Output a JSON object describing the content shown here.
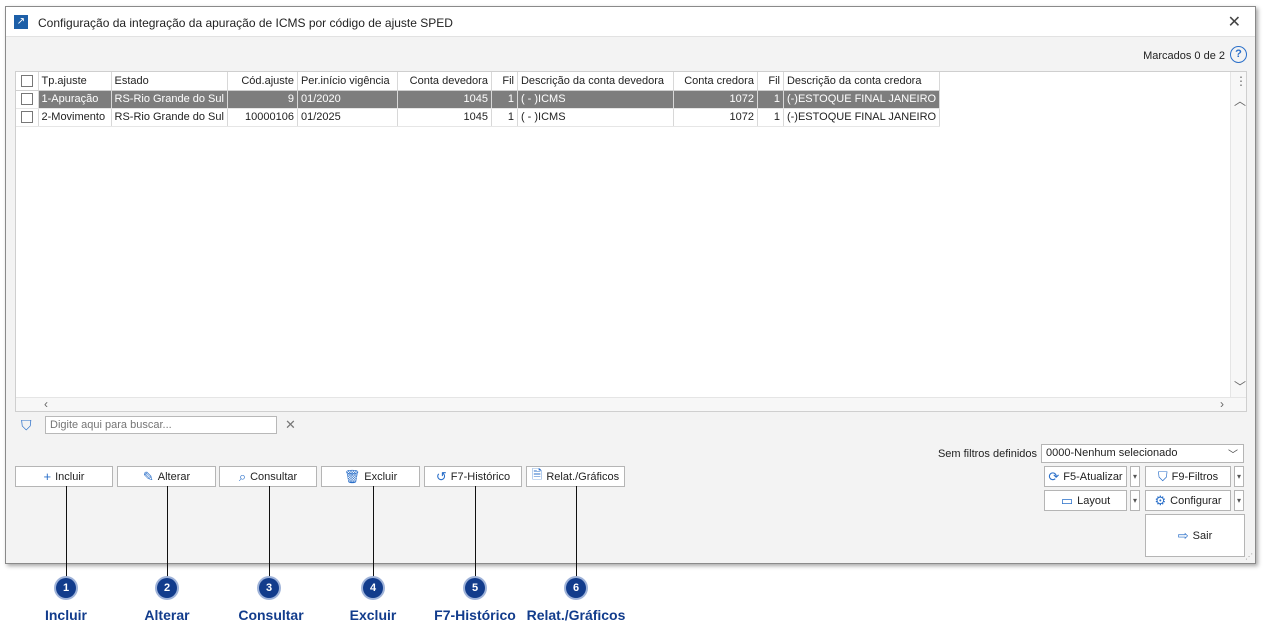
{
  "window": {
    "title": "Configuração da integração da apuração de ICMS por código de ajuste SPED",
    "marked": "Marcados 0 de 2",
    "help": "?"
  },
  "grid": {
    "columns": [
      "Tp.ajuste",
      "Estado",
      "Cód.ajuste",
      "Per.início vigência",
      "Conta devedora",
      "Fil",
      "Descrição da conta devedora",
      "Conta credora",
      "Fil",
      "Descrição da conta credora"
    ],
    "rows": [
      [
        "1-Apuração",
        "RS-Rio Grande do Sul",
        "9",
        "01/2020",
        "1045",
        "1",
        "( - )ICMS",
        "1072",
        "1",
        "(-)ESTOQUE FINAL JANEIRO"
      ],
      [
        "2-Movimento",
        "RS-Rio Grande do Sul",
        "10000106",
        "01/2025",
        "1045",
        "1",
        "( - )ICMS",
        "1072",
        "1",
        "(-)ESTOQUE FINAL JANEIRO"
      ]
    ]
  },
  "search": {
    "placeholder": "Digite aqui para buscar..."
  },
  "buttons": {
    "incluir": "Incluir",
    "alterar": "Alterar",
    "consultar": "Consultar",
    "excluir": "Excluir",
    "historico": "F7-Histórico",
    "relat": "Relat./Gráficos",
    "atualizar": "F5-Atualizar",
    "filtros": "F9-Filtros",
    "layout": "Layout",
    "configurar": "Configurar",
    "sair": "Sair"
  },
  "filters": {
    "label": "Sem filtros definidos",
    "selected": "0000-Nenhum selecionado"
  },
  "annotations": [
    {
      "num": "1",
      "label": "Incluir"
    },
    {
      "num": "2",
      "label": "Alterar"
    },
    {
      "num": "3",
      "label": "Consultar"
    },
    {
      "num": "4",
      "label": "Excluir"
    },
    {
      "num": "5",
      "label": "F7-Histórico"
    },
    {
      "num": "6",
      "label": "Relat./Gráficos"
    }
  ],
  "colors": {
    "accent": "#2a6fc9",
    "annotation": "#123c8c",
    "selected_row": "#7d7d7d"
  }
}
